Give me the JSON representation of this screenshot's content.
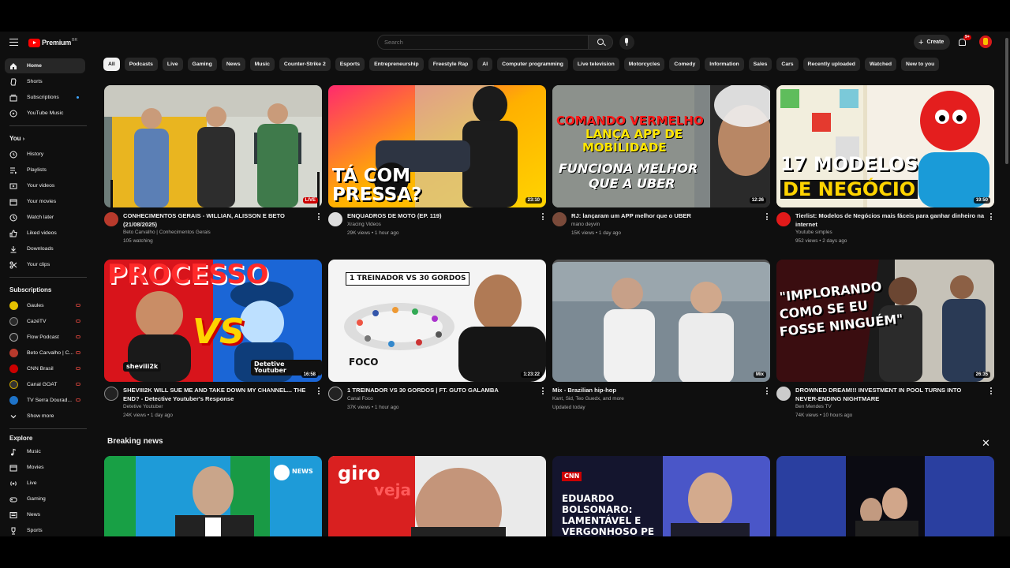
{
  "header": {
    "logo_text": "Premium",
    "logo_region": "BR",
    "search_placeholder": "Search",
    "create_label": "Create",
    "notification_count": "9+"
  },
  "chips": [
    "All",
    "Podcasts",
    "Live",
    "Gaming",
    "News",
    "Music",
    "Counter-Strike 2",
    "Esports",
    "Entrepreneurship",
    "Freestyle Rap",
    "AI",
    "Computer programming",
    "Live television",
    "Motorcycles",
    "Comedy",
    "Information",
    "Sales",
    "Cars",
    "Recently uploaded",
    "Watched",
    "New to you"
  ],
  "sidebar": {
    "main": [
      "Home",
      "Shorts",
      "Subscriptions",
      "YouTube Music"
    ],
    "you_heading": "You",
    "you_items": [
      "History",
      "Playlists",
      "Your videos",
      "Your movies",
      "Watch later",
      "Liked videos",
      "Downloads",
      "Your clips"
    ],
    "subs_heading": "Subscriptions",
    "subs": [
      "Gaules",
      "CazéTV",
      "Flow Podcast",
      "Beto Carvalho | C...",
      "CNN Brasil",
      "Canal GOAT",
      "TV Serra Dourad..."
    ],
    "show_more": "Show more",
    "explore_heading": "Explore",
    "explore": [
      "Music",
      "Movies",
      "Live",
      "Gaming",
      "News",
      "Sports"
    ]
  },
  "videos": [
    {
      "title": "CONHECIMENTOS GERAIS - WILLIAN, ALISSON E BETO (21/08/2025)",
      "channel": "Beto Carvalho | Conhecimentos Gerais",
      "stats": "105 watching",
      "badge": "LIVE"
    },
    {
      "title": "ENQUADROS DE MOTO (EP. 119)",
      "channel": "Xracing Videos",
      "stats": "29K views • 1 hour ago",
      "badge": "23:10",
      "thumb_text": [
        "TÁ COM",
        "PRESSA?"
      ]
    },
    {
      "title": "RJ: lançaram um APP melhor que o UBER",
      "channel": "mano deyvin",
      "stats": "15K views • 1 day ago",
      "badge": "12:26",
      "thumb_text": [
        "COMANDO VERMELHO",
        "LANÇA APP DE",
        "MOBILIDADE",
        "FUNCIONA MELHOR",
        "QUE A UBER"
      ]
    },
    {
      "title": "Tierlist: Modelos de Negócios mais fáceis para ganhar dinheiro na internet",
      "channel": "Youtube simples",
      "stats": "952 views • 2 days ago",
      "badge": "19:50",
      "thumb_text": [
        "17 MODELOS",
        "DE NEGÓCIO"
      ]
    },
    {
      "title": "SHEVIII2K WILL SUE ME AND TAKE DOWN MY CHANNEL... THE END? - Detective Youtuber's Response",
      "channel": "Detetive Youtuber",
      "stats": "24K views • 1 day ago",
      "badge": "16:58",
      "thumb_text": [
        "PROCESSO",
        "VS",
        "sheviii2k",
        "Detetive Youtuber"
      ]
    },
    {
      "title": "1 TREINADOR VS 30 GORDOS | FT. GUTO GALAMBA",
      "channel": "Canal Foco",
      "stats": "37K views • 1 hour ago",
      "badge": "1:23:22",
      "thumb_text": [
        "1 TREINADOR VS 30 GORDOS",
        "FOCO"
      ]
    },
    {
      "title": "Mix - Brazilian hip-hop",
      "channel": "Kant, Sid, Teo Guedx, and more",
      "stats": "Updated today",
      "badge": "Mix"
    },
    {
      "title": "DROWNED DREAM!!! INVESTMENT IN POOL TURNS INTO NEVER-ENDING NIGHTMARE",
      "channel": "Ben Mendes TV",
      "stats": "74K views • 10 hours ago",
      "badge": "26:35",
      "thumb_text": [
        "\"IMPLORANDO",
        "COMO SE EU",
        "FOSSE NINGUÉM\""
      ]
    }
  ],
  "breaking": {
    "title": "Breaking news",
    "thumbs": [
      {
        "text": [
          "NEWS"
        ]
      },
      {
        "text": [
          "giro",
          "veja"
        ]
      },
      {
        "text": [
          "CNN",
          "EDUARDO",
          "BOLSONARO:",
          "LAMENTÁVEL E",
          "VERGONHOSO PE"
        ]
      },
      {
        "text": []
      }
    ]
  },
  "colors": {
    "accent": "#ff0000",
    "bg": "#0f0f0f",
    "chip": "#272727"
  }
}
